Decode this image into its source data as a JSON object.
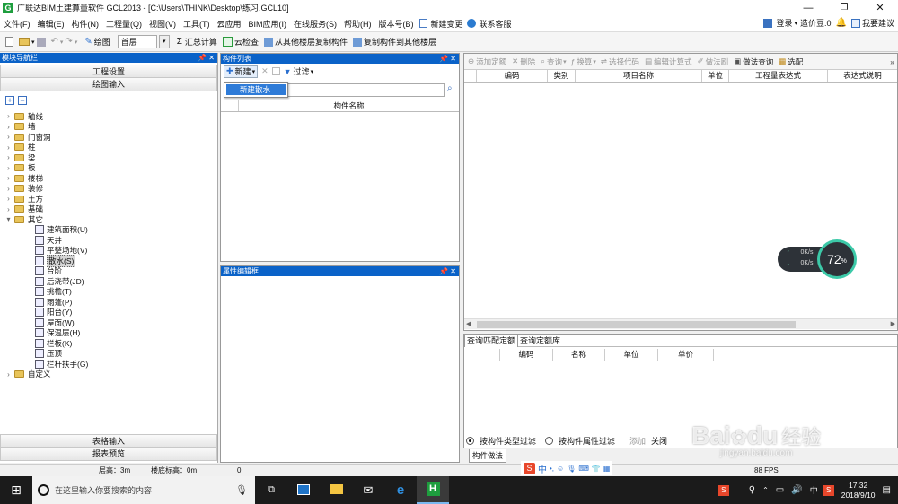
{
  "window": {
    "title": "广联达BIM土建算量软件 GCL2013 - [C:\\Users\\THINK\\Desktop\\练习.GCL10]"
  },
  "menu": [
    "文件(F)",
    "编辑(E)",
    "构件(N)",
    "工程量(Q)",
    "视图(V)",
    "工具(T)",
    "云应用",
    "BIM应用(I)",
    "在线服务(S)",
    "帮助(H)",
    "版本号(B)",
    "新建变更",
    "联系客服"
  ],
  "menu_right": {
    "login": "登录",
    "price_bean": "造价豆:0",
    "suggest": "我要建议"
  },
  "toolbar": {
    "draw": "绘图",
    "floor": "首层",
    "sum_calc": "汇总计算",
    "cloud_check": "云检查",
    "copy_from": "从其他楼层复制构件",
    "copy_to": "复制构件到其他楼层"
  },
  "nav": {
    "title": "模块导航栏",
    "project_settings": "工程设置",
    "drawing_input": "绘图输入",
    "tree": [
      {
        "label": "轴线",
        "type": "folder",
        "expanded": false
      },
      {
        "label": "墙",
        "type": "folder",
        "expanded": false
      },
      {
        "label": "门窗洞",
        "type": "folder",
        "expanded": false
      },
      {
        "label": "柱",
        "type": "folder",
        "expanded": false
      },
      {
        "label": "梁",
        "type": "folder",
        "expanded": false
      },
      {
        "label": "板",
        "type": "folder",
        "expanded": false
      },
      {
        "label": "楼梯",
        "type": "folder",
        "expanded": false
      },
      {
        "label": "装修",
        "type": "folder",
        "expanded": false
      },
      {
        "label": "土方",
        "type": "folder",
        "expanded": false
      },
      {
        "label": "基础",
        "type": "folder",
        "expanded": false
      },
      {
        "label": "其它",
        "type": "folder",
        "expanded": true
      },
      {
        "label": "建筑面积(U)",
        "type": "leaf"
      },
      {
        "label": "天井",
        "type": "leaf"
      },
      {
        "label": "平整场地(V)",
        "type": "leaf"
      },
      {
        "label": "散水(S)",
        "type": "leaf",
        "selected": true
      },
      {
        "label": "台阶",
        "type": "leaf"
      },
      {
        "label": "后浇带(JD)",
        "type": "leaf"
      },
      {
        "label": "挑檐(T)",
        "type": "leaf"
      },
      {
        "label": "雨篷(P)",
        "type": "leaf"
      },
      {
        "label": "阳台(Y)",
        "type": "leaf"
      },
      {
        "label": "屋面(W)",
        "type": "leaf"
      },
      {
        "label": "保温层(H)",
        "type": "leaf"
      },
      {
        "label": "栏板(K)",
        "type": "leaf"
      },
      {
        "label": "压顶",
        "type": "leaf"
      },
      {
        "label": "栏杆扶手(G)",
        "type": "leaf"
      },
      {
        "label": "自定义",
        "type": "folder",
        "expanded": false
      }
    ],
    "table_input": "表格输入",
    "report_preview": "报表预览"
  },
  "component_list": {
    "title": "构件列表",
    "new_btn": "新建",
    "filter_btn": "过滤",
    "dropdown_item": "新建散水",
    "col_name": "构件名称"
  },
  "property_editor": {
    "title": "属性编辑框"
  },
  "right_toolbar": [
    "添加定额",
    "删除",
    "查询",
    "换算",
    "选择代码",
    "编辑计算式",
    "做法刷",
    "做法查询",
    "选配"
  ],
  "right_grid_headers": [
    "编码",
    "类别",
    "项目名称",
    "单位",
    "工程量表达式",
    "表达式说明"
  ],
  "bottom_tabs": [
    "查询匹配定额",
    "查询定额库"
  ],
  "bottom_grid_headers": [
    "编码",
    "名称",
    "单位",
    "单价"
  ],
  "filter_options": {
    "by_type": "按构件类型过滤",
    "by_prop": "按构件属性过滤",
    "add": "添加",
    "close": "关闭"
  },
  "bottom_tab2": "构件做法",
  "speed_widget": {
    "up": "0K/s",
    "down": "0K/s",
    "percent": "72",
    "percent_sign": "%"
  },
  "status": {
    "floor_height": "层高：3m",
    "base_elevation": "楼底标高：0m",
    "zero": "0",
    "fps": "88 FPS"
  },
  "watermark": {
    "brand": "Bai",
    "brand2": "du",
    "text": "经验",
    "url": "jingyan.baidu.com"
  },
  "taskbar": {
    "search_placeholder": "在这里输入你要搜索的内容",
    "time": "17:32",
    "date": "2018/9/10",
    "ime": "中"
  }
}
